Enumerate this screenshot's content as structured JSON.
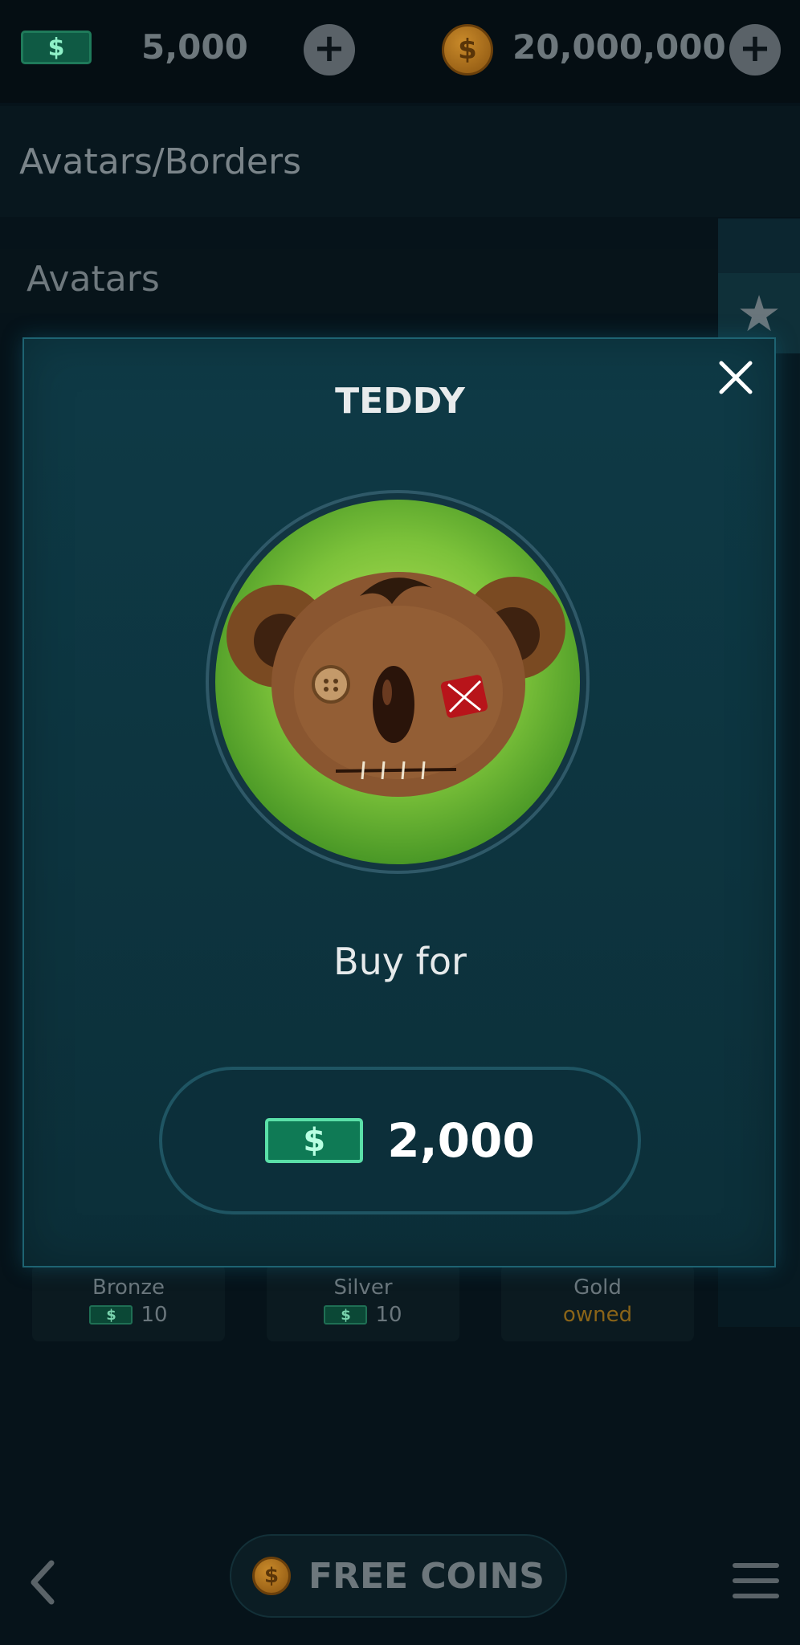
{
  "topbar": {
    "cash_icon": "dollar-bill-icon",
    "cash_symbol": "$",
    "cash_amount": "5,000",
    "coin_icon": "coin-icon",
    "coin_symbol": "$",
    "coin_amount": "20,000,000",
    "plus_symbol": "+"
  },
  "page": {
    "section_title": "Avatars/Borders",
    "subsection_title": "Avatars",
    "side_icon": "star-icon"
  },
  "border_cards": [
    {
      "label": "Bronze",
      "currency_symbol": "$",
      "price": "10"
    },
    {
      "label": "Silver",
      "currency_symbol": "$",
      "price": "10"
    },
    {
      "label": "Gold",
      "status": "owned"
    }
  ],
  "bottom": {
    "free_coins_label": "FREE COINS",
    "coin_symbol": "$"
  },
  "modal": {
    "title": "TEDDY",
    "avatar": "teddy-bear-avatar",
    "buy_for_label": "Buy for",
    "currency_symbol": "$",
    "price": "2,000",
    "close_icon": "close-icon"
  },
  "colors": {
    "background": "#06131a",
    "modal_bg": "#0e3a46",
    "cash_green": "#0f7a55",
    "coin_gold": "#c98a2a"
  }
}
